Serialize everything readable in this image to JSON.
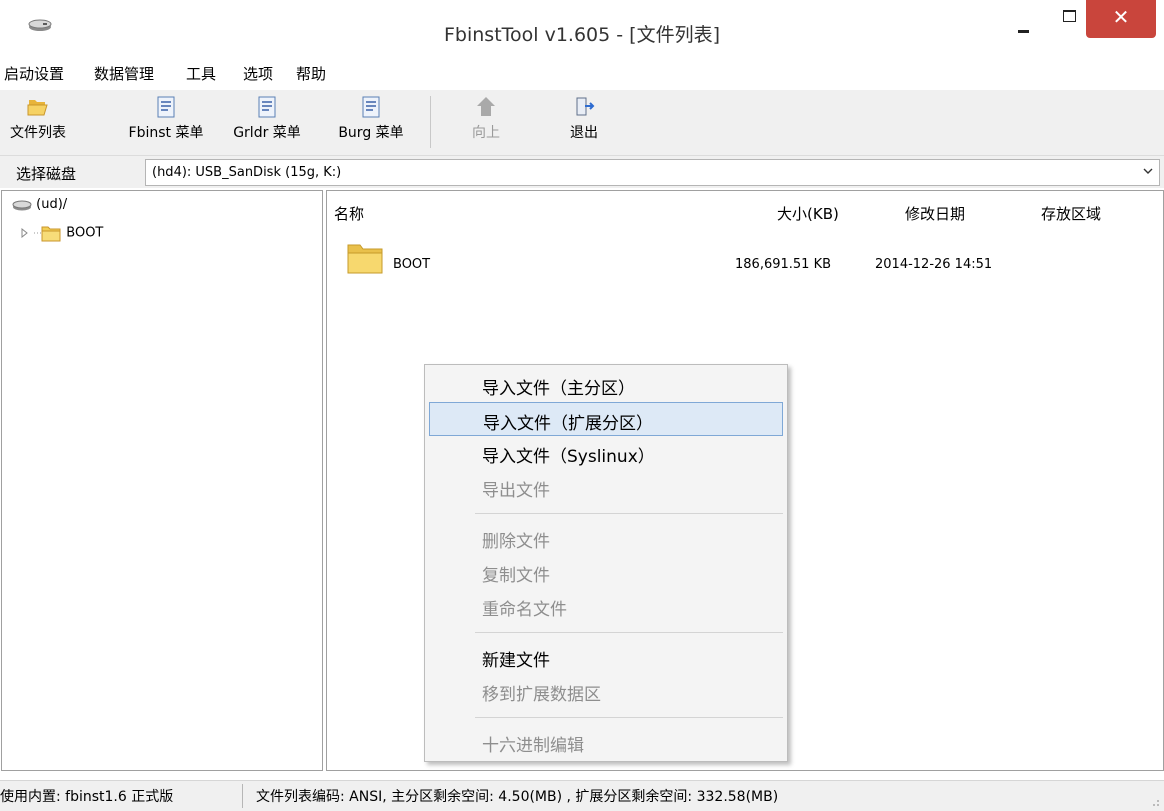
{
  "window": {
    "title": "FbinstTool v1.605 - [文件列表]",
    "controls": {
      "minimize": "minimize",
      "maximize": "maximize",
      "close_glyph": "✕"
    }
  },
  "menubar": [
    "启动设置",
    "数据管理",
    "工具",
    "选项",
    "帮助"
  ],
  "toolbar": {
    "file_list": "文件列表",
    "fbinst_menu": "Fbinst 菜单",
    "grldr_menu": "Grldr 菜单",
    "burg_menu": "Burg 菜单",
    "up": "向上",
    "exit": "退出"
  },
  "disk": {
    "label": "选择磁盘",
    "value": "(hd4): USB_SanDisk (15g, K:)"
  },
  "tree": {
    "root": "(ud)/",
    "children": [
      "BOOT"
    ]
  },
  "list": {
    "columns": [
      "名称",
      "大小(KB)",
      "修改日期",
      "存放区域"
    ],
    "rows": [
      {
        "name": "BOOT",
        "size": "186,691.51 KB",
        "modified": "2014-12-26 14:51",
        "area": ""
      }
    ]
  },
  "context_menu": {
    "items": [
      {
        "label": "导入文件（主分区）",
        "enabled": true
      },
      {
        "label": "导入文件（扩展分区）",
        "enabled": true,
        "highlighted": true
      },
      {
        "label": "导入文件（Syslinux）",
        "enabled": true
      },
      {
        "label": "导出文件",
        "enabled": false
      },
      {
        "label": "删除文件",
        "enabled": false
      },
      {
        "label": "复制文件",
        "enabled": false
      },
      {
        "label": "重命名文件",
        "enabled": false
      },
      {
        "label": "新建文件",
        "enabled": true
      },
      {
        "label": "移到扩展数据区",
        "enabled": false
      },
      {
        "label": "十六进制编辑",
        "enabled": false
      }
    ]
  },
  "status": {
    "left": "使用内置: fbinst1.6 正式版",
    "right": "文件列表编码: ANSI, 主分区剩余空间: 4.50(MB) , 扩展分区剩余空间: 332.58(MB)"
  },
  "colors": {
    "close_button": "#c9453c",
    "menu_highlight": "#dde9f6",
    "folder_yellow": "#f2cf56",
    "toolbar_bg": "#f0f0f0"
  }
}
